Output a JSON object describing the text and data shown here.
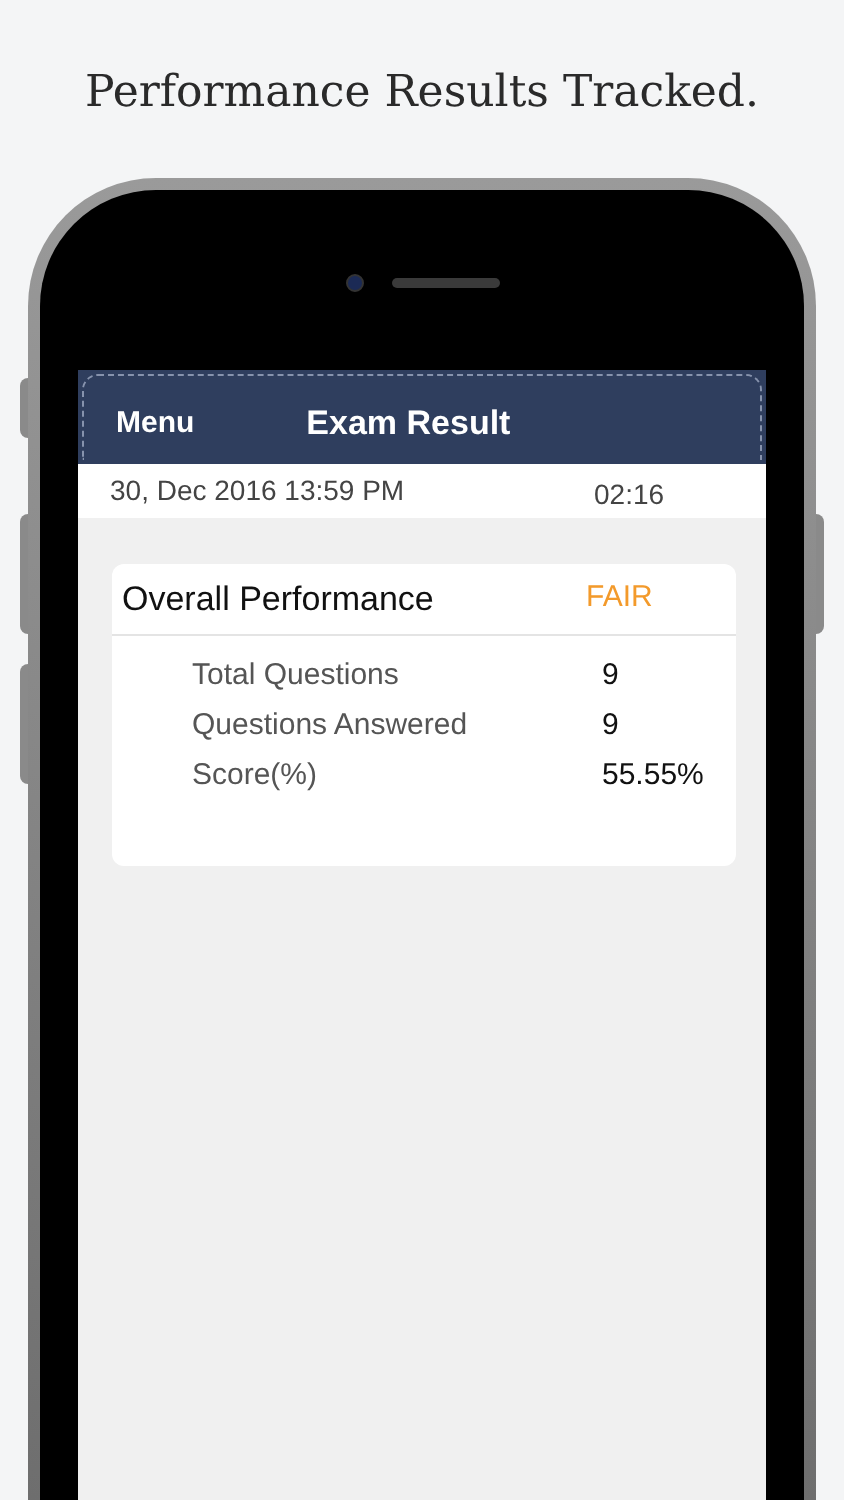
{
  "headline": "Performance Results Tracked.",
  "nav": {
    "menu": "Menu",
    "title": "Exam Result"
  },
  "info_row": {
    "datetime": "30, Dec 2016 13:59 PM",
    "duration": "02:16"
  },
  "card": {
    "title": "Overall Performance",
    "rating": "FAIR",
    "rows": [
      {
        "label": "Total Questions",
        "value": "9"
      },
      {
        "label": "Questions Answered",
        "value": "9"
      },
      {
        "label": "Score(%)",
        "value": "55.55%"
      }
    ]
  }
}
